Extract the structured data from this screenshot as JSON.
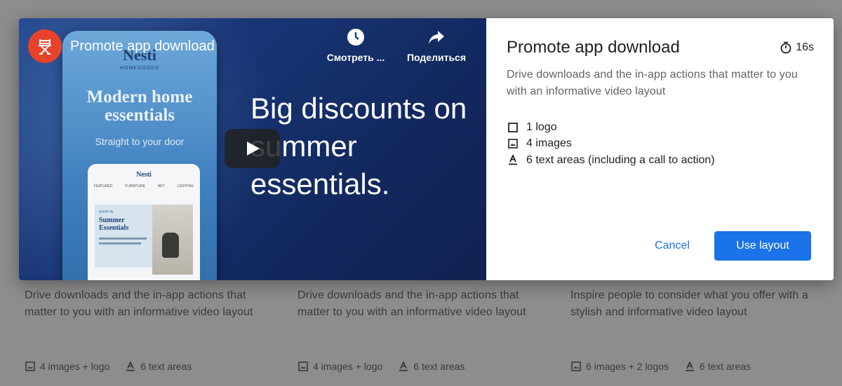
{
  "modal": {
    "video": {
      "title": "Promote app download",
      "watch_later_label": "Смотреть ...",
      "share_label": "Поделиться",
      "ad_brand": "Nesti",
      "ad_brand_sub": "HOMEGOODS",
      "ad_headline": "Modern home essentials",
      "ad_tagline": "Straight to your door",
      "ad_inner_brand": "Nesti",
      "ad_inner_nav": [
        "FEATURED",
        "FURNITURE",
        "ART",
        "LIGHTING"
      ],
      "ad_inner_kicker": "SHOP IN",
      "ad_inner_title": "Summer Essentials",
      "big_text": "Big discounts on summer essentials."
    },
    "details": {
      "title": "Promote app download",
      "duration": "16s",
      "description": "Drive downloads and the in-app actions that matter to you with an informative video layout",
      "specs": [
        {
          "icon": "square-icon",
          "label": "1 logo"
        },
        {
          "icon": "image-icon",
          "label": "4 images"
        },
        {
          "icon": "text-icon",
          "label": "6 text areas (including a call to action)"
        }
      ],
      "cancel_label": "Cancel",
      "use_label": "Use layout"
    }
  },
  "background_cards": [
    {
      "description": "Drive downloads and the in-app actions that matter to you with an informative video layout",
      "images": "4 images + logo",
      "text_areas": "6 text areas"
    },
    {
      "description": "Drive downloads and the in-app actions that matter to you with an informative video layout",
      "images": "4 images + logo",
      "text_areas": "6 text areas"
    },
    {
      "description": "Inspire people to consider what you offer with a stylish and informative video layout",
      "images": "6 images + 2 logos",
      "text_areas": "6 text areas"
    }
  ],
  "colors": {
    "accent": "#1a73e8",
    "overlay": "#8d8d8d",
    "yt_logo": "#e8432a"
  }
}
